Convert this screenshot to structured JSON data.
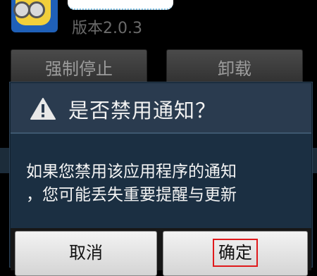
{
  "app": {
    "version": "版本2.0.3"
  },
  "background_buttons": {
    "force_stop": "强制停止",
    "uninstall": "卸载"
  },
  "dialog": {
    "title": "是否禁用通知？",
    "message_lines": [
      "如果您禁用该应用程序的通知",
      "，您可能丢失重要提醒与更新"
    ],
    "buttons": {
      "cancel": "取消",
      "ok": "确定"
    },
    "icons": {
      "title": "warning-icon"
    }
  },
  "colors": {
    "dialog_bg": "#1b2f42",
    "title_bar_bg": "#2a3b4f",
    "highlight": "#e0191b"
  }
}
